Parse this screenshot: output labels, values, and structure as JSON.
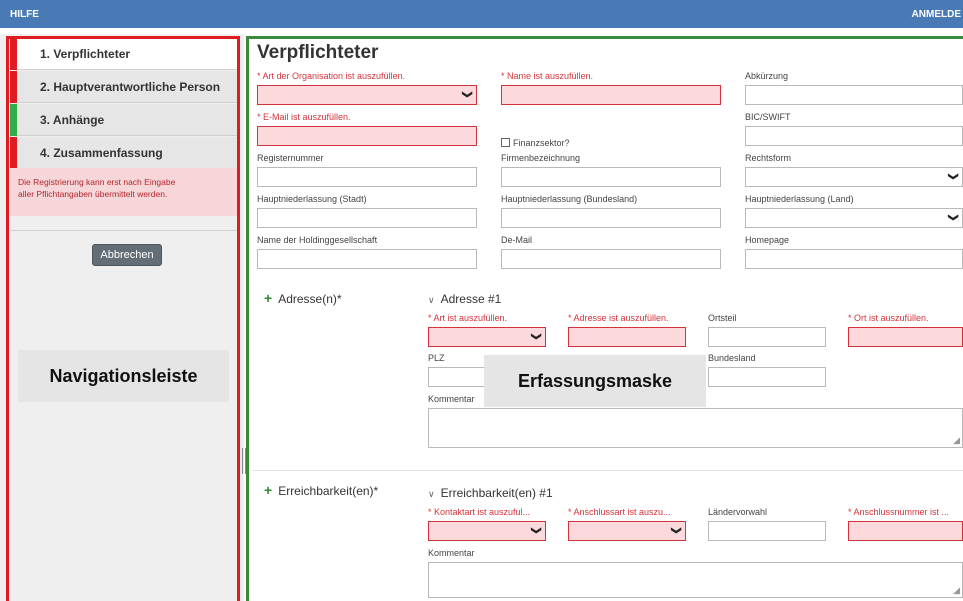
{
  "topbar": {
    "help": "HILFE",
    "login": "ANMELDE"
  },
  "sidebar": {
    "steps": [
      {
        "label": "1. Verpflichteter",
        "flag_color": "#e01b22"
      },
      {
        "label": "2. Hauptverantwortliche Person",
        "flag_color": "#e01b22"
      },
      {
        "label": "3. Anhänge",
        "flag_color": "#2fae4a"
      },
      {
        "label": "4. Zusammenfassung",
        "flag_color": "#e01b22"
      }
    ],
    "notice_line1": "Die Registrierung kann erst nach Eingabe",
    "notice_line2": "aller Pflichtangaben übermittelt werden.",
    "cancel_label": "Abbrechen"
  },
  "annotations": {
    "nav": "Navigationsleiste",
    "mask": "Erfassungsmaske"
  },
  "form": {
    "title": "Verpflichteter",
    "org_type_label": "* Art der Organisation ist auszufüllen.",
    "name_label": "* Name ist auszufüllen.",
    "abbr_label": "Abkürzung",
    "email_label": "* E-Mail ist auszufüllen.",
    "finance_sector_label": "Finanzsektor?",
    "bic_label": "BIC/SWIFT",
    "register_label": "Registernummer",
    "company_label": "Firmenbezeichnung",
    "legal_form_label": "Rechtsform",
    "hq_city_label": "Hauptniederlassung (Stadt)",
    "hq_state_label": "Hauptniederlassung (Bundesland)",
    "hq_country_label": "Hauptniederlassung (Land)",
    "holding_label": "Name der Holdinggesellschaft",
    "demail_label": "De-Mail",
    "homepage_label": "Homepage"
  },
  "address": {
    "section_label": "Adresse(n)*",
    "item_title": "Adresse #1",
    "type_label": "* Art ist auszufüllen.",
    "address_label": "* Adresse ist auszufüllen.",
    "district_label": "Ortsteil",
    "city_label": "* Ort ist auszufüllen.",
    "zip_label": "PLZ",
    "state_label": "Bundesland",
    "comment_label": "Kommentar"
  },
  "contact": {
    "section_label": "Erreichbarkeit(en)*",
    "item_title": "Erreichbarkeit(en) #1",
    "contact_type_label": "* Kontaktart ist auszuful...",
    "connection_type_label": "* Anschlussart ist auszu...",
    "country_code_label": "Ländervorwahl",
    "number_label": "* Anschlussnummer ist ...",
    "comment_label": "Kommentar"
  },
  "icons": {
    "plus": "+",
    "chevron": "∨",
    "dropdown": "❯",
    "resize": "◢"
  },
  "colors": {
    "topbar": "#4a7ab5",
    "error": "#d3343c",
    "error_fill": "#fbd9dd",
    "nav_frame": "#e01b22",
    "mask_frame": "#3a8a3a"
  }
}
